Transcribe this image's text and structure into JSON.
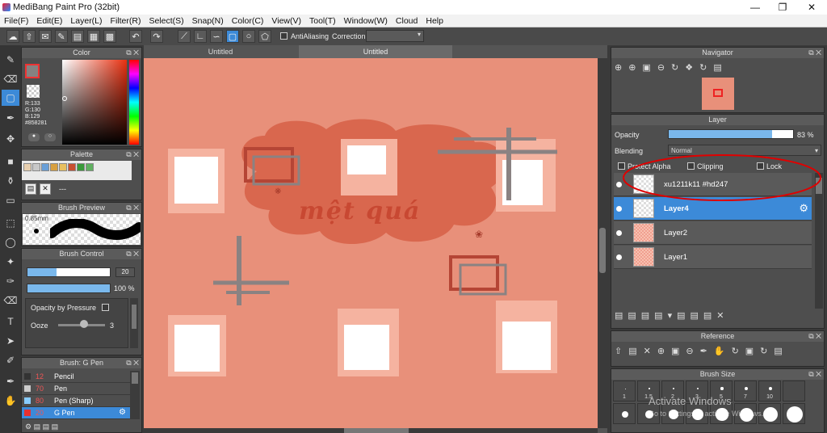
{
  "app": {
    "title": "MediBang Paint Pro (32bit)"
  },
  "menu": [
    "File(F)",
    "Edit(E)",
    "Layer(L)",
    "Filter(R)",
    "Select(S)",
    "Snap(N)",
    "Color(C)",
    "View(V)",
    "Tool(T)",
    "Window(W)",
    "Cloud",
    "Help"
  ],
  "toolbar": {
    "antialias_label": "AntiAliasing",
    "correction_label": "Correction"
  },
  "color_panel": {
    "title": "Color",
    "r": "R:133",
    "g": "G:130",
    "b": "B:129",
    "hex": "#858281"
  },
  "palette_panel": {
    "title": "Palette",
    "swatches": [
      "#e8d0b0",
      "#c8c8c8",
      "#6aa0d8",
      "#d8a040",
      "#e8c060",
      "#c85030",
      "#3a9a3a",
      "#60b060"
    ],
    "dash": "---"
  },
  "brush_preview": {
    "title": "Brush Preview",
    "size": "0.85mm"
  },
  "brush_control": {
    "title": "Brush Control",
    "size_value": "20",
    "opacity_value": "100 %",
    "size_fill": 0.35,
    "opacity_fill": 1.0,
    "opacity_by_pressure": "Opacity by Pressure",
    "ooze_label": "Ooze",
    "ooze_value": "3"
  },
  "brush_list": {
    "title": "Brush: G Pen",
    "items": [
      {
        "size": "12",
        "name": "Pencil",
        "color": "#333"
      },
      {
        "size": "70",
        "name": "Pen",
        "color": "#ccc"
      },
      {
        "size": "80",
        "name": "Pen (Sharp)",
        "color": "#88ccff"
      },
      {
        "size": "20",
        "name": "G Pen",
        "color": "#e83030"
      }
    ]
  },
  "tabs": [
    "Untitled",
    "Untitled"
  ],
  "canvas": {
    "text": "mệt quá",
    "bg": "#e8907a"
  },
  "navigator": {
    "title": "Navigator"
  },
  "layer_panel": {
    "title": "Layer",
    "opacity_label": "Opacity",
    "opacity_value": "83 %",
    "opacity_fill": 0.83,
    "blending_label": "Blending",
    "blending_value": "Normal",
    "protect_alpha": "Protect Alpha",
    "clipping": "Clipping",
    "lock": "Lock",
    "layers": [
      {
        "name": "xu1211k11 #hd247",
        "selected": false
      },
      {
        "name": "Layer4",
        "selected": true
      },
      {
        "name": "Layer2",
        "selected": false
      },
      {
        "name": "Layer1",
        "selected": false
      }
    ]
  },
  "reference": {
    "title": "Reference"
  },
  "brush_size": {
    "title": "Brush Size",
    "labels": [
      "1",
      "1.5",
      "2",
      "3",
      "5",
      "7",
      "10"
    ],
    "watermark_1": "Activate Windows",
    "watermark_2": "Go to Settings to activate Windows."
  }
}
